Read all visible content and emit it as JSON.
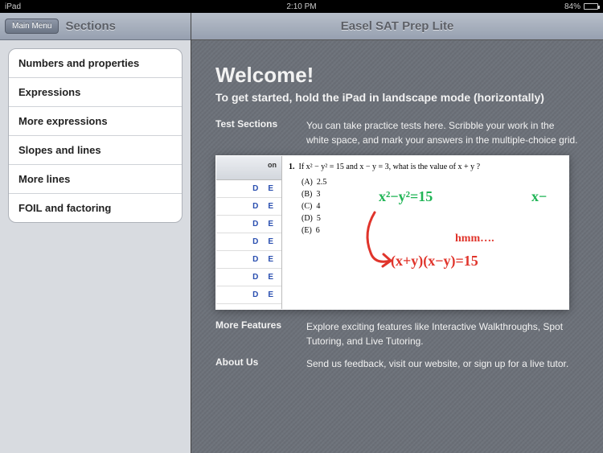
{
  "statusbar": {
    "carrier": "iPad",
    "time": "2:10 PM",
    "battery": "84%"
  },
  "sidebar": {
    "back_label": "Main Menu",
    "title": "Sections",
    "items": [
      {
        "label": "Numbers and properties"
      },
      {
        "label": "Expressions"
      },
      {
        "label": "More expressions"
      },
      {
        "label": "Slopes and lines"
      },
      {
        "label": "More lines"
      },
      {
        "label": "FOIL and factoring"
      }
    ]
  },
  "main": {
    "title": "Easel SAT Prep Lite",
    "welcome": "Welcome!",
    "subheading": "To get started, hold the iPad in landscape mode (horizontally)",
    "sections": {
      "test_label": "Test Sections",
      "test_desc": "You can take practice tests here. Scribble your work in the white space, and mark your answers in the multiple-choice grid.",
      "more_label": "More Features",
      "more_desc": "Explore exciting features like Interactive Walkthroughs, Spot Tutoring, and Live Tutoring.",
      "about_label": "About Us",
      "about_desc": "Send us feedback, visit our website, or sign up for a live tutor."
    },
    "example": {
      "grid_header": "on",
      "choice_letters": [
        "D",
        "E"
      ],
      "q_number": "1.",
      "q_text": "If x² − y² = 15 and x − y = 3, what is the value of  x + y ?",
      "choices": [
        {
          "letter": "(A)",
          "val": "2.5"
        },
        {
          "letter": "(B)",
          "val": "3"
        },
        {
          "letter": "(C)",
          "val": "4"
        },
        {
          "letter": "(D)",
          "val": "5"
        },
        {
          "letter": "(E)",
          "val": "6"
        }
      ],
      "hand_eq1": "x²−y²=15",
      "hand_eq1b": "x−",
      "hand_hmm": "hmm….",
      "hand_eq2": "(x+y)(x−y)=15"
    }
  }
}
